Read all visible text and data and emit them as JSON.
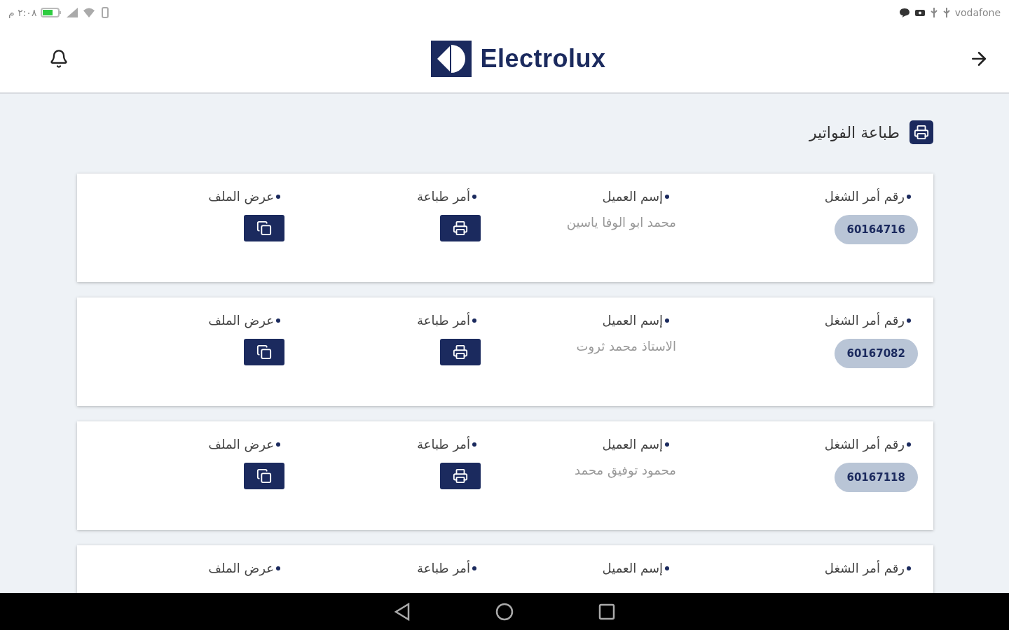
{
  "status_bar": {
    "time": "٢:٠٨ م",
    "carrier": "vodafone"
  },
  "header": {
    "logo_text": "Electrolux"
  },
  "page_title": "طباعة الفواتير",
  "orders": [
    {
      "labels": [
        "رقم أمر الشغل",
        "إسم العميل",
        "أمر طباعة",
        "عرض الملف"
      ],
      "order_no": "60164716",
      "customer": "محمد ابو الوفا ياسين"
    },
    {
      "labels": [
        "رقم أمر الشغل",
        "إسم العميل",
        "أمر طباعة",
        "عرض الملف"
      ],
      "order_no": "60167082",
      "customer": "الاستاذ محمد ثروت"
    },
    {
      "labels": [
        "رقم أمر الشغل",
        "إسم العميل",
        "أمر طباعة",
        "عرض الملف"
      ],
      "order_no": "60167118",
      "customer": "محمود توفيق محمد"
    },
    {
      "labels": [
        "رقم أمر الشغل",
        "إسم العميل",
        "أمر طباعة",
        "عرض الملف"
      ]
    }
  ]
}
